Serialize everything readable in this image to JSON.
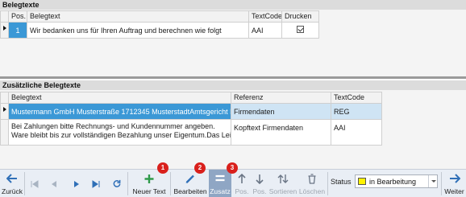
{
  "section1": {
    "title": "Belegtexte",
    "columns": [
      "Pos.",
      "Belegtext",
      "TextCode",
      "Drucken"
    ],
    "rows": [
      {
        "pos": "1",
        "text": "Wir bedanken uns für Ihren Auftrag und berechnen wie folgt",
        "code": "AAI",
        "print": true
      }
    ]
  },
  "section2": {
    "title": "Zusätzliche Belegtexte",
    "columns": [
      "Belegtext",
      "Referenz",
      "TextCode"
    ],
    "rows": [
      {
        "text": "Mustermann GmbH Musterstraße 1712345 MusterstadtAmtsgericht Must...",
        "ref": "Firmendaten",
        "code": "REG"
      },
      {
        "text": "Bei Zahlungen bitte Rechnungs- und Kundennummer angeben.",
        "text2": "Ware bleibt bis zur vollständigen Bezahlung unser Eigentum.Das Leistung...",
        "ref": "Kopftext Firmendaten",
        "code": "AAI"
      }
    ]
  },
  "toolbar": {
    "back": "Zurück",
    "new_text": "Neuer Text",
    "edit": "Bearbeiten",
    "extra": "Zusatz",
    "pos_up": "Pos.",
    "pos_down": "Pos.",
    "sort": "Sortieren",
    "delete": "Löschen",
    "status_label": "Status",
    "status_value": "in Bearbeitung",
    "next": "Weiter",
    "badges": [
      "1",
      "2",
      "3"
    ]
  },
  "colors": {
    "selection": "#3b98d6",
    "status_swatch": "#fff200",
    "badge": "#d9201c",
    "add_icon": "#2e9a4a",
    "nav_icon": "#2f6fb7"
  }
}
